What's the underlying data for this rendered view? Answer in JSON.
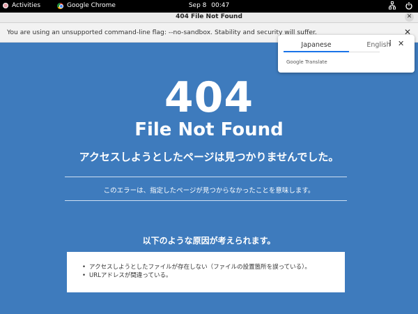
{
  "topbar": {
    "activities": "Activities",
    "app_name": "Google Chrome",
    "date": "Sep 8",
    "time": "00:47"
  },
  "window": {
    "title": "404 File Not Found"
  },
  "infobar": {
    "message": "You are using an unsupported command-line flag: --no-sandbox. Stability and security will suffer."
  },
  "translate": {
    "tab_source": "Japanese",
    "tab_target": "English",
    "brand": "Google Translate"
  },
  "page": {
    "code": "404",
    "heading": "File Not Found",
    "jp_heading": "アクセスしようとしたページは見つかりませんでした。",
    "jp_description": "このエラーは、指定したページが見つからなかったことを意味します。",
    "jp_cause_heading": "以下のような原因が考えられます。",
    "causes": [
      "アクセスしようとしたファイルが存在しない（ファイルの設置箇所を誤っている）。",
      "URLアドレスが間違っている。"
    ]
  },
  "colors": {
    "background": "#3e7bbd",
    "accent": "#1a73e8"
  }
}
